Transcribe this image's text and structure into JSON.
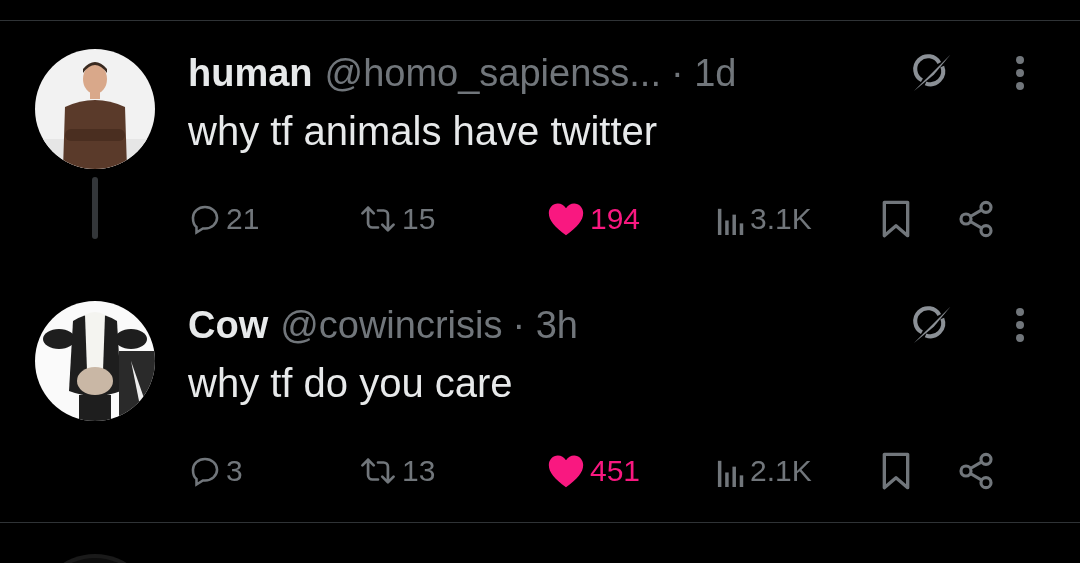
{
  "tweets": [
    {
      "kind": "man",
      "name": "human",
      "handle": "@homo_sapienss...",
      "time": "· 1d",
      "text": "why tf animals have twitter",
      "replies": "21",
      "reposts": "15",
      "likes": "194",
      "liked": true,
      "views": "3.1K",
      "thread_below": true
    },
    {
      "kind": "cow",
      "name": "Cow",
      "handle": "@cowincrisis",
      "time": "· 3h",
      "text": "why tf do you care",
      "replies": "3",
      "reposts": "13",
      "likes": "451",
      "liked": true,
      "views": "2.1K",
      "thread_below": false
    }
  ]
}
